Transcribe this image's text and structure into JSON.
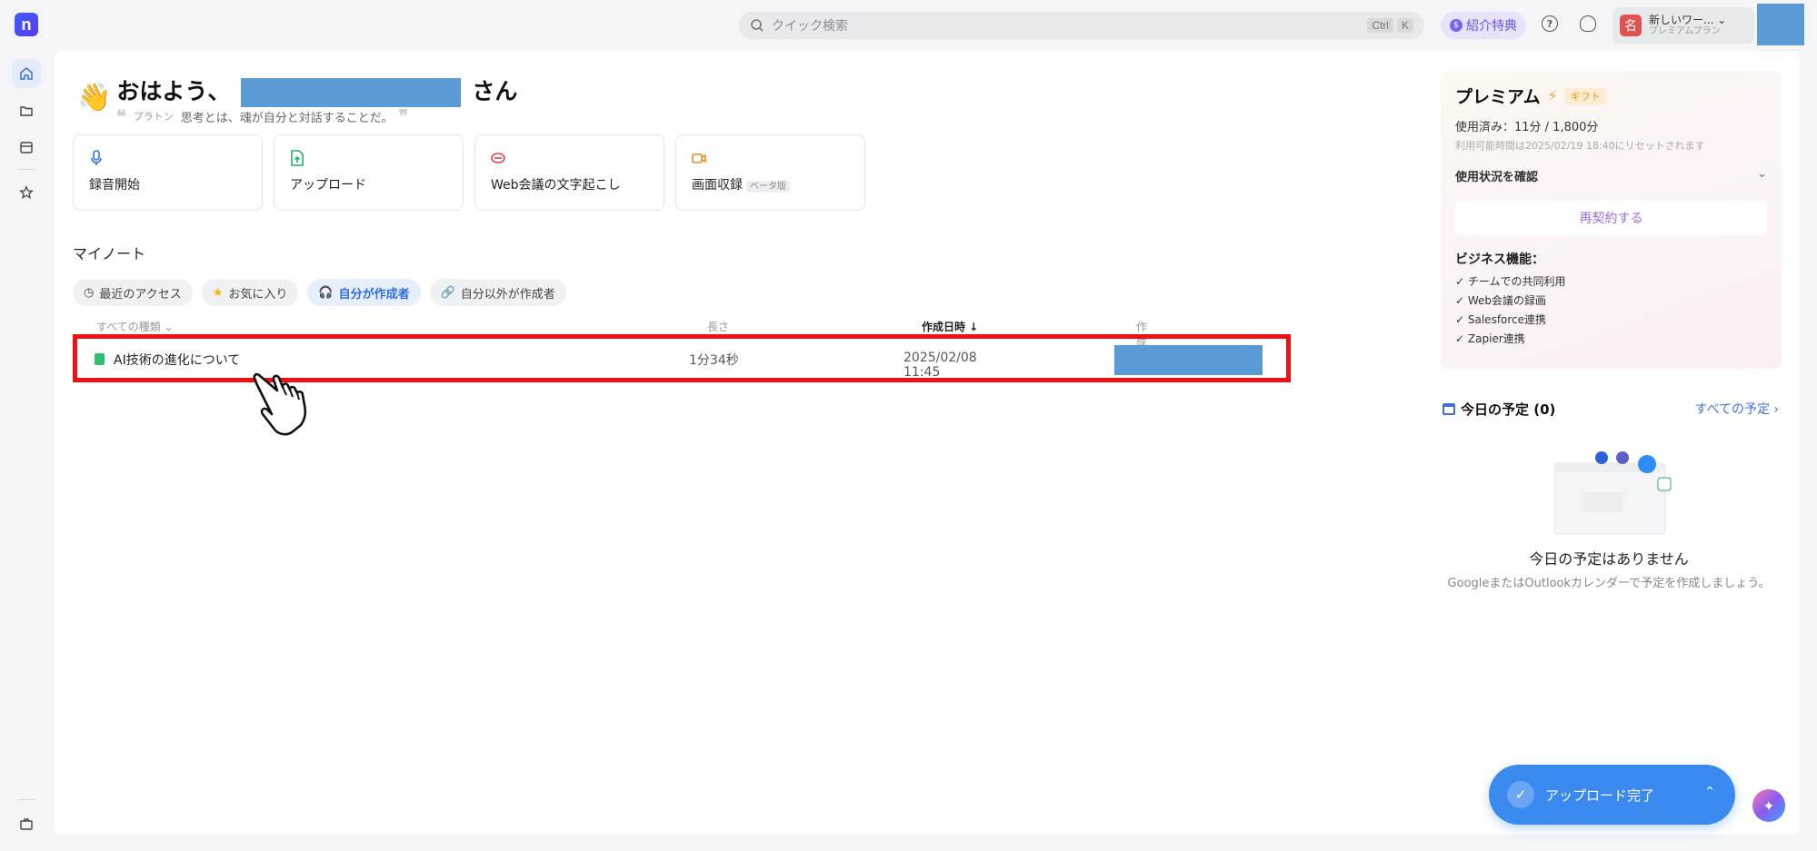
{
  "topbar": {
    "logo_letter": "n",
    "search_placeholder": "クイック検索",
    "shortcut_ctrl": "Ctrl",
    "shortcut_k": "K",
    "referral_label": "紹介特典",
    "workspace_avatar": "名",
    "workspace_name": "新しいワー...",
    "workspace_plan": "プレミアムプラン"
  },
  "greeting": {
    "hello": "おはよう、",
    "suffix": "さん",
    "quote_author": "プラトン",
    "quote_text": "思考とは、魂が自分と対話することだ。"
  },
  "actions": [
    {
      "label": "録音開始"
    },
    {
      "label": "アップロード"
    },
    {
      "label": "Web会議の文字起こし"
    },
    {
      "label": "画面収録",
      "badge": "ベータ版"
    }
  ],
  "notes": {
    "section_title": "マイノート",
    "filters": [
      {
        "label": "最近のアクセス"
      },
      {
        "label": "お気に入り"
      },
      {
        "label": "自分が作成者"
      },
      {
        "label": "自分以外が作成者"
      }
    ],
    "columns": {
      "type": "すべての種類 ⌄",
      "length": "長さ",
      "created": "作成日時 ↓",
      "creator": "作成者"
    },
    "rows": [
      {
        "title": "AI技術の進化について",
        "length": "1分34秒",
        "created": "2025/02/08 11:45"
      }
    ]
  },
  "premium": {
    "title": "プレミアム",
    "gift": "ギフト",
    "used": "使用済み：11分 / 1,800分",
    "reset": "利用可能時間は2025/02/19 18:40にリセットされます",
    "check_usage": "使用状況を確認",
    "renew": "再契約する",
    "biz_title": "ビジネス機能：",
    "features": [
      "チームでの共同利用",
      "Web会議の録画",
      "Salesforce連携",
      "Zapier連携"
    ]
  },
  "schedule": {
    "title": "今日の予定 (0)",
    "view_all": "すべての予定 ›",
    "empty_title": "今日の予定はありません",
    "empty_sub": "GoogleまたはOutlookカレンダーで予定を作成しましょう。"
  },
  "toast": {
    "label": "アップロード完了"
  },
  "colors": {
    "accent": "#3a89ee",
    "highlight": "#ee1111",
    "redaction": "#5b9bd5"
  }
}
